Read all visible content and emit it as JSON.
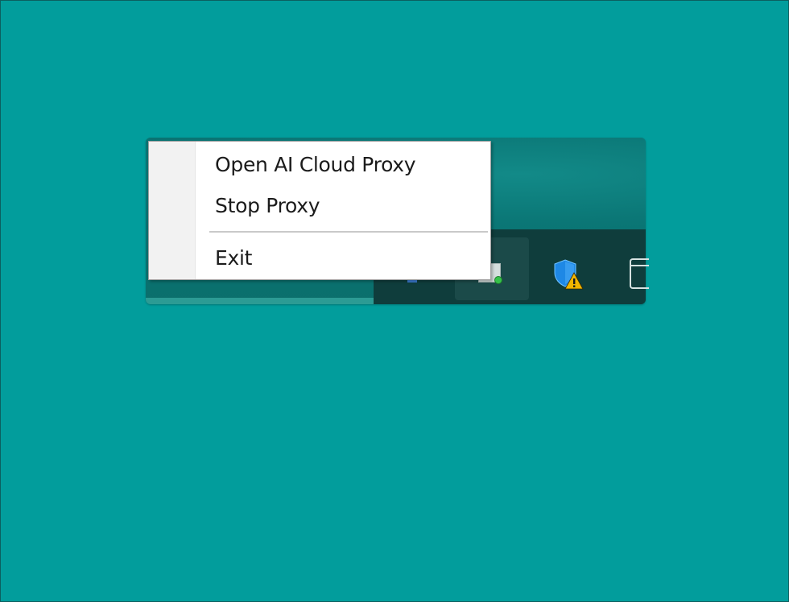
{
  "context_menu": {
    "items": [
      {
        "label": "Open AI Cloud Proxy"
      },
      {
        "label": "Stop Proxy"
      },
      {
        "label": "Exit"
      }
    ]
  },
  "tray": {
    "icons": [
      "partial-app-icon",
      "ai-cloud-proxy-tray-icon",
      "windows-security-warning-icon",
      "window-icon"
    ]
  },
  "colors": {
    "desktop": "#029d9c",
    "taskbar": "#0f3d3c",
    "menu_background": "#ffffff",
    "menu_gutter": "#f2f2f2",
    "menu_text": "#1b1b1b",
    "warning": "#f2b600",
    "shield": "#1e88e5",
    "status_dot": "#36c24a"
  }
}
